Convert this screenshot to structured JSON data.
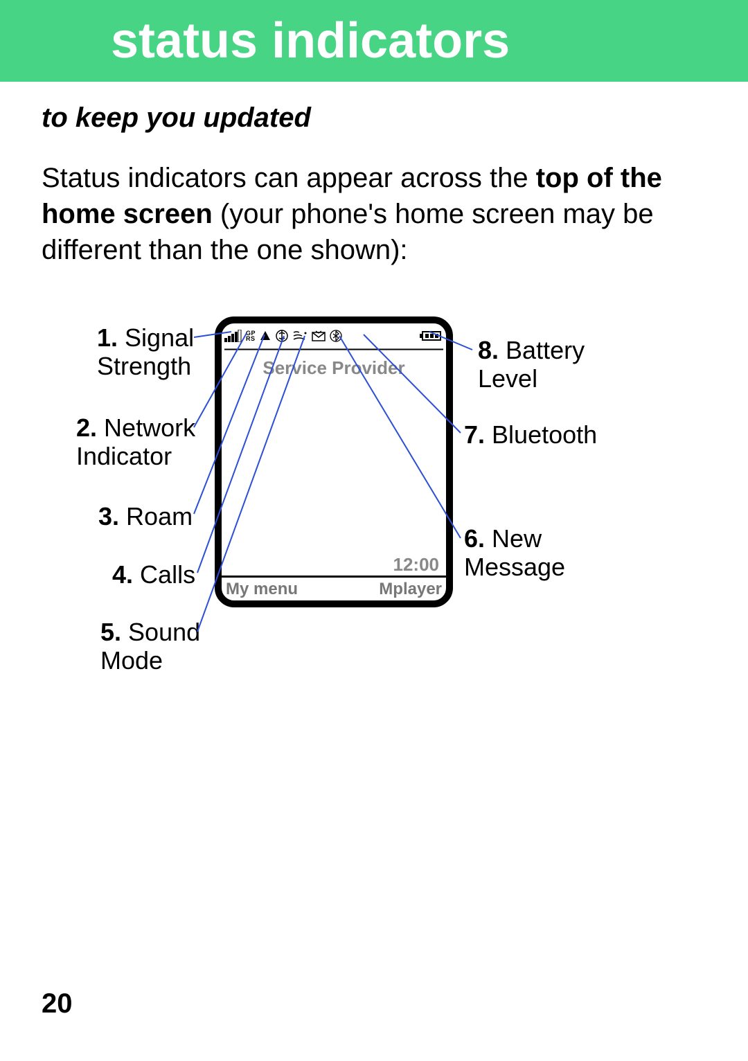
{
  "banner": {
    "title": "status indicators"
  },
  "subtitle": "to keep you updated",
  "paragraph": {
    "pre": "Status indicators can appear across the ",
    "bold": "top of the home screen",
    "post": " (your phone's home screen may be different than the one shown):"
  },
  "callouts": {
    "left": [
      {
        "num": "1.",
        "label": "Signal\nStrength"
      },
      {
        "num": "2.",
        "label": "Network\nIndicator"
      },
      {
        "num": "3.",
        "label": "Roam"
      },
      {
        "num": "4.",
        "label": "Calls"
      },
      {
        "num": "5.",
        "label": "Sound\nMode"
      }
    ],
    "right": [
      {
        "num": "8.",
        "label": "Battery\nLevel"
      },
      {
        "num": "7.",
        "label": "Bluetooth"
      },
      {
        "num": "6.",
        "label": "New\nMessage"
      }
    ]
  },
  "phone": {
    "provider": "Service Provider",
    "clock": "12:00",
    "soft_left": "My menu",
    "soft_right": "Mplayer",
    "icons": [
      "signal-icon",
      "gprs-icon",
      "roam-icon",
      "calls-icon",
      "sound-icon",
      "message-icon",
      "bluetooth-icon",
      "battery-icon"
    ]
  },
  "page_number": "20"
}
